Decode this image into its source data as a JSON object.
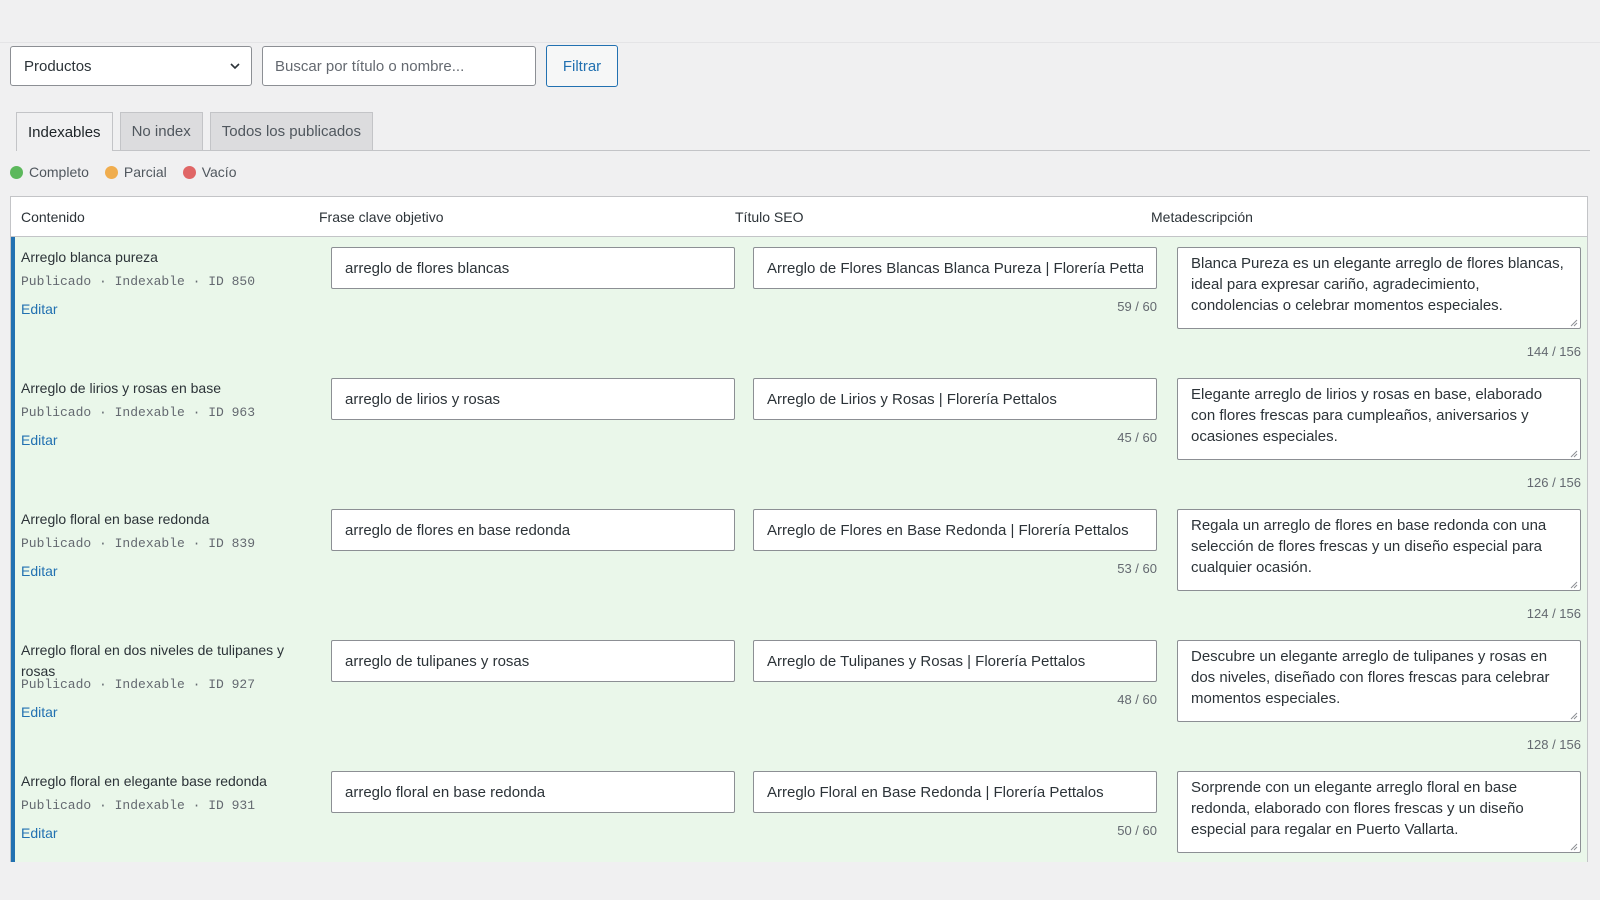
{
  "filter": {
    "post_type": "Productos",
    "search_placeholder": "Buscar por título o nombre...",
    "button_label": "Filtrar"
  },
  "tabs": [
    {
      "label": "Indexables",
      "active": true
    },
    {
      "label": "No index",
      "active": false
    },
    {
      "label": "Todos los publicados",
      "active": false
    }
  ],
  "legend": [
    {
      "label": "Completo",
      "color": "#5cb85c"
    },
    {
      "label": "Parcial",
      "color": "#f0ad4e"
    },
    {
      "label": "Vacío",
      "color": "#e06666"
    }
  ],
  "table": {
    "headers": [
      "Contenido",
      "Frase clave objetivo",
      "Título SEO",
      "Metadescripción"
    ],
    "rows": [
      {
        "title": "Arreglo blanca pureza",
        "meta": "Publicado · Indexable · ID 850",
        "edit": "Editar",
        "keyword": "arreglo de flores blancas",
        "seo_title": "Arreglo de Flores Blancas Blanca Pureza | Florería Pettalos",
        "seo_count": "59 / 60",
        "description": "Blanca Pureza es un elegante arreglo de flores blancas, ideal para expresar cariño, agradecimiento, condolencias o celebrar momentos especiales.",
        "desc_count": "144 / 156"
      },
      {
        "title": "Arreglo de lirios y rosas en base",
        "meta": "Publicado · Indexable · ID 963",
        "edit": "Editar",
        "keyword": "arreglo de lirios y rosas",
        "seo_title": "Arreglo de Lirios y Rosas | Florería Pettalos",
        "seo_count": "45 / 60",
        "description": "Elegante arreglo de lirios y rosas en base, elaborado con flores frescas para cumpleaños, aniversarios y ocasiones especiales.",
        "desc_count": "126 / 156"
      },
      {
        "title": "Arreglo floral en base redonda",
        "meta": "Publicado · Indexable · ID 839",
        "edit": "Editar",
        "keyword": "arreglo de flores en base redonda",
        "seo_title": "Arreglo de Flores en Base Redonda | Florería Pettalos",
        "seo_count": "53 / 60",
        "description": "Regala un arreglo de flores en base redonda con una selección de flores frescas y un diseño especial para cualquier ocasión.",
        "desc_count": "124 / 156"
      },
      {
        "title": "Arreglo floral en dos niveles de tulipanes y rosas",
        "meta": "Publicado · Indexable · ID 927",
        "edit": "Editar",
        "keyword": "arreglo de tulipanes y rosas",
        "seo_title": "Arreglo de Tulipanes y Rosas | Florería Pettalos",
        "seo_count": "48 / 60",
        "description": "Descubre un elegante arreglo de tulipanes y rosas en dos niveles, diseñado con flores frescas para celebrar momentos especiales.",
        "desc_count": "128 / 156"
      },
      {
        "title": "Arreglo floral en elegante base redonda",
        "meta": "Publicado · Indexable · ID 931",
        "edit": "Editar",
        "keyword": "arreglo floral en base redonda",
        "seo_title": "Arreglo Floral en Base Redonda | Florería Pettalos",
        "seo_count": "50 / 60",
        "description": "Sorprende con un elegante arreglo floral en base redonda, elaborado con flores frescas y un diseño especial para regalar en Puerto Vallarta.",
        "desc_count": ""
      }
    ]
  }
}
